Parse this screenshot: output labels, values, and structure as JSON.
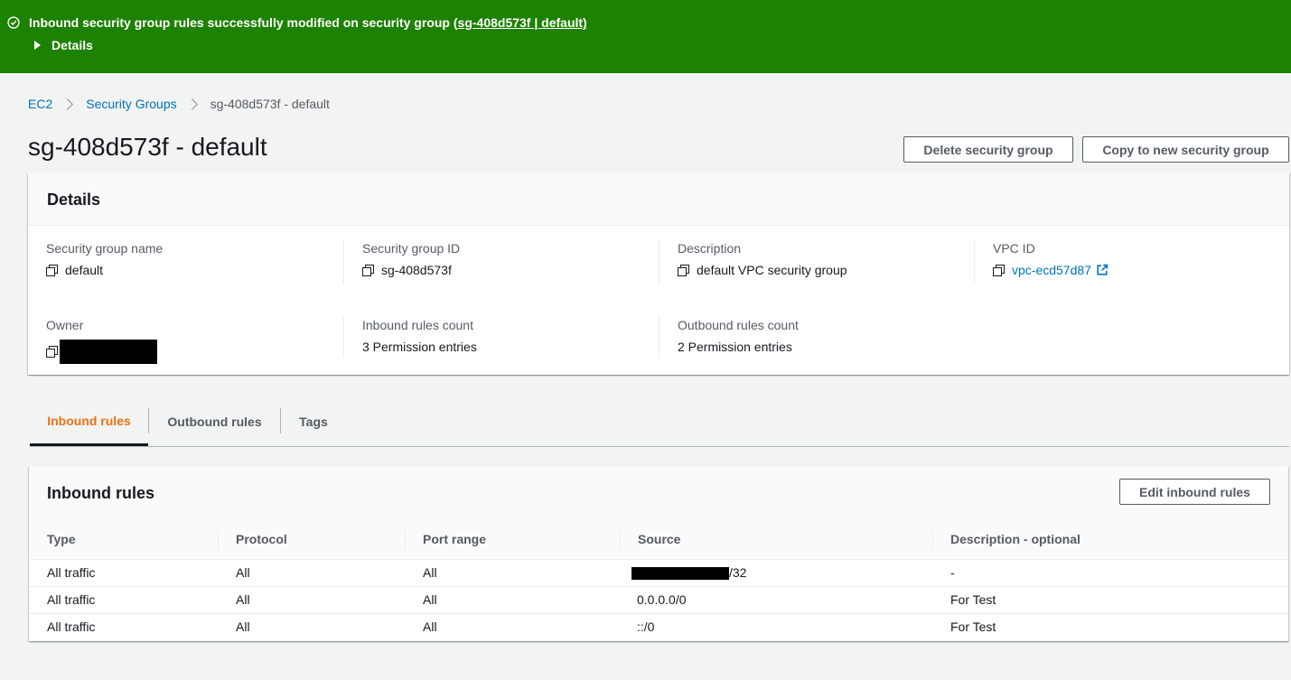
{
  "flash": {
    "message": "Inbound security group rules successfully modified on security group (",
    "link": "sg-408d573f | default)",
    "details_label": "Details",
    "color": "#1d8102"
  },
  "breadcrumb": {
    "items": [
      "EC2",
      "Security Groups"
    ],
    "current": "sg-408d573f - default"
  },
  "header": {
    "title": "sg-408d573f - default",
    "delete_label": "Delete security group",
    "copy_label": "Copy to new security group"
  },
  "details": {
    "title": "Details",
    "fields": [
      {
        "label": "Security group name",
        "value": "default"
      },
      {
        "label": "Security group ID",
        "value": "sg-408d573f"
      },
      {
        "label": "Description",
        "value": "default VPC security group"
      },
      {
        "label": "VPC ID",
        "value": "vpc-ecd57d87"
      },
      {
        "label": "Owner",
        "value": ""
      },
      {
        "label": "Inbound rules count",
        "value": "3 Permission entries"
      },
      {
        "label": "Outbound rules count",
        "value": "2 Permission entries"
      }
    ]
  },
  "tabs": [
    "Inbound rules",
    "Outbound rules",
    "Tags"
  ],
  "inbound": {
    "title": "Inbound rules",
    "edit_label": "Edit inbound rules",
    "columns": [
      "Type",
      "Protocol",
      "Port range",
      "Source",
      "Description - optional"
    ],
    "rows": [
      [
        "All traffic",
        "All",
        "All",
        "/32",
        "-"
      ],
      [
        "All traffic",
        "All",
        "All",
        "0.0.0.0/0",
        "For Test"
      ],
      [
        "All traffic",
        "All",
        "All",
        "::/0",
        "For Test"
      ]
    ]
  },
  "colors": {
    "accent_tab": "#ec7211",
    "link": "#0073bb",
    "text_secondary": "#545b64"
  },
  "icons": [
    "check-circle-icon",
    "caret-right-icon",
    "chevron-right-icon",
    "copy-icon",
    "external-link-icon"
  ]
}
